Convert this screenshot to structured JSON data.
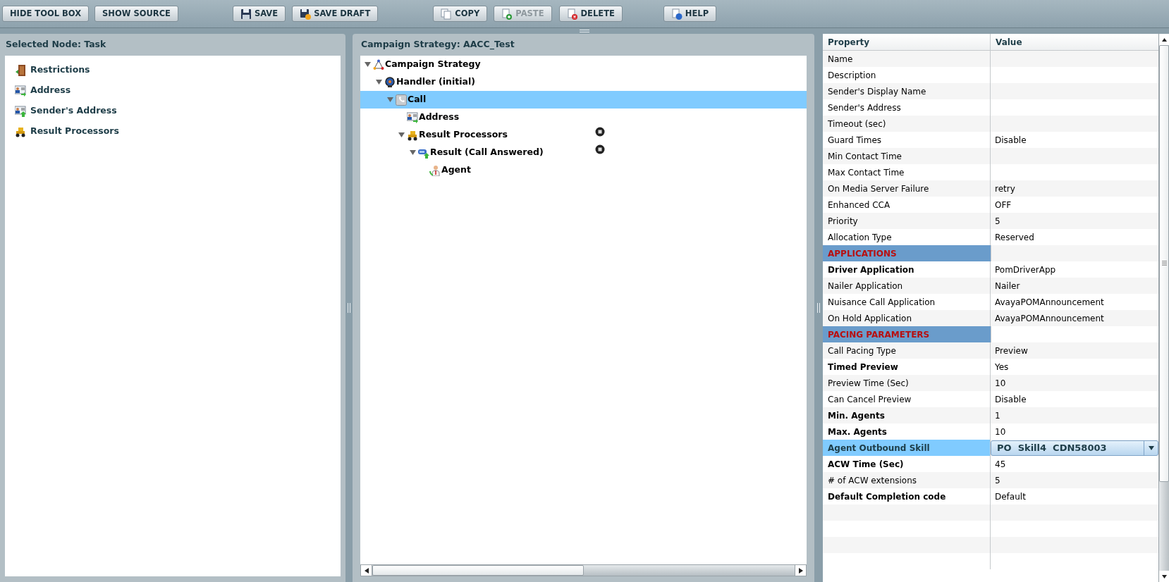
{
  "toolbar": [
    {
      "label": "HIDE TOOL BOX",
      "kind": "plain",
      "disabled": false
    },
    {
      "label": "SHOW SOURCE",
      "kind": "plain",
      "disabled": false
    },
    {
      "label": "SAVE",
      "kind": "save",
      "disabled": false
    },
    {
      "label": "SAVE DRAFT",
      "kind": "draft",
      "disabled": false
    },
    {
      "label": "COPY",
      "kind": "copy",
      "disabled": false
    },
    {
      "label": "PASTE",
      "kind": "paste",
      "disabled": true
    },
    {
      "label": "DELETE",
      "kind": "delete",
      "disabled": false
    },
    {
      "label": "HELP",
      "kind": "help",
      "disabled": false
    }
  ],
  "toolbox": {
    "title": "Selected Node: Task",
    "items": [
      {
        "label": "Restrictions",
        "kind": "door"
      },
      {
        "label": "Address",
        "kind": "card-in"
      },
      {
        "label": "Sender's Address",
        "kind": "card-up"
      },
      {
        "label": "Result Processors",
        "kind": "loader"
      }
    ]
  },
  "strategy": {
    "title": "Campaign Strategy: AACC_Test",
    "tree": [
      {
        "label": "Campaign Strategy",
        "kind": "graph",
        "selected": false,
        "marked": false,
        "expanded": true,
        "children": [
          {
            "label": "Handler (initial)",
            "kind": "wheel",
            "selected": false,
            "marked": false,
            "expanded": true,
            "children": [
              {
                "label": "Call",
                "kind": "phone",
                "selected": true,
                "marked": false,
                "expanded": true,
                "children": [
                  {
                    "label": "Address",
                    "kind": "card-in",
                    "selected": false,
                    "marked": false
                  },
                  {
                    "label": "Result Processors",
                    "kind": "loader",
                    "selected": false,
                    "marked": true,
                    "expanded": true,
                    "children": [
                      {
                        "label": "Result (Call Answered)",
                        "kind": "result",
                        "selected": false,
                        "marked": true,
                        "expanded": true,
                        "children": [
                          {
                            "label": "Agent",
                            "kind": "person",
                            "selected": false,
                            "marked": false
                          }
                        ]
                      }
                    ]
                  }
                ]
              }
            ]
          }
        ]
      }
    ]
  },
  "properties": {
    "columns": [
      "Property",
      "Value"
    ],
    "rows": [
      {
        "kind": "property",
        "name": "Name",
        "bold": false,
        "selected": false
      },
      {
        "kind": "property",
        "name": "Description",
        "bold": false,
        "selected": false
      },
      {
        "kind": "property",
        "name": "Sender's Display Name",
        "bold": false,
        "selected": false
      },
      {
        "kind": "property",
        "name": "Sender's Address",
        "bold": false,
        "selected": false
      },
      {
        "kind": "property",
        "name": "Timeout (sec)",
        "bold": false,
        "selected": false
      },
      {
        "kind": "property",
        "name": "Guard Times",
        "value": "Disable",
        "bold": false,
        "selected": false
      },
      {
        "kind": "property",
        "name": "Min Contact Time",
        "bold": false,
        "selected": false
      },
      {
        "kind": "property",
        "name": "Max Contact Time",
        "bold": false,
        "selected": false
      },
      {
        "kind": "property",
        "name": "On Media Server Failure",
        "value": "retry",
        "bold": false,
        "selected": false
      },
      {
        "kind": "property",
        "name": "Enhanced CCA",
        "value": "OFF",
        "bold": false,
        "selected": false
      },
      {
        "kind": "property",
        "name": "Priority",
        "value": "5",
        "bold": false,
        "selected": false
      },
      {
        "kind": "property",
        "name": "Allocation Type",
        "value": "Reserved",
        "bold": false,
        "selected": false
      },
      {
        "kind": "section",
        "name": "APPLICATIONS"
      },
      {
        "kind": "property",
        "name": "Driver Application",
        "value": "PomDriverApp",
        "bold": true,
        "selected": false
      },
      {
        "kind": "property",
        "name": "Nailer Application",
        "value": "Nailer",
        "bold": false,
        "selected": false
      },
      {
        "kind": "property",
        "name": "Nuisance Call Application",
        "value": "AvayaPOMAnnouncement",
        "bold": false,
        "selected": false
      },
      {
        "kind": "property",
        "name": "On Hold Application",
        "value": "AvayaPOMAnnouncement",
        "bold": false,
        "selected": false
      },
      {
        "kind": "section",
        "name": "PACING PARAMETERS"
      },
      {
        "kind": "property",
        "name": "Call Pacing Type",
        "value": "Preview",
        "bold": false,
        "selected": false
      },
      {
        "kind": "property",
        "name": "Timed Preview",
        "value": "Yes",
        "bold": true,
        "selected": false
      },
      {
        "kind": "property",
        "name": "Preview Time (Sec)",
        "value": "10",
        "bold": false,
        "selected": false
      },
      {
        "kind": "property",
        "name": "Can Cancel Preview",
        "value": "Disable",
        "bold": false,
        "selected": false
      },
      {
        "kind": "property",
        "name": "Min. Agents",
        "value": "1",
        "bold": true,
        "selected": false
      },
      {
        "kind": "property",
        "name": "Max. Agents",
        "value": "10",
        "bold": true,
        "selected": false
      },
      {
        "kind": "dropdown",
        "name": "Agent Outbound Skill",
        "value": "PO  Skill4  CDN58003",
        "bold": true,
        "selected": true
      },
      {
        "kind": "property",
        "name": "ACW Time (Sec)",
        "value": "45",
        "bold": true,
        "selected": false
      },
      {
        "kind": "property",
        "name": "# of ACW extensions",
        "value": "5",
        "bold": false,
        "selected": false
      },
      {
        "kind": "property",
        "name": "Default Completion code",
        "value": "Default",
        "bold": true,
        "selected": false
      }
    ]
  }
}
